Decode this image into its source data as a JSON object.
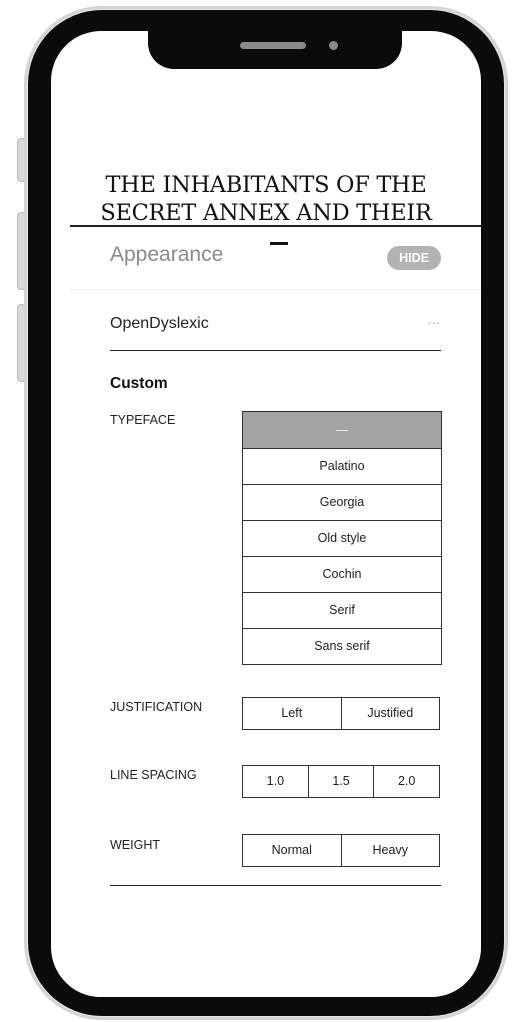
{
  "book": {
    "title_lines": [
      "THE INHABITANTS OF THE",
      "SECRET ANNEX AND THEIR"
    ]
  },
  "panel": {
    "title": "Appearance",
    "hide_label": "HIDE",
    "font_preset": "OpenDyslexic",
    "more_icon": "...",
    "custom_heading": "Custom"
  },
  "typeface": {
    "label": "TYPEFACE",
    "selected": "—",
    "options": [
      "Palatino",
      "Georgia",
      "Old style",
      "Cochin",
      "Serif",
      "Sans serif"
    ]
  },
  "justification": {
    "label": "JUSTIFICATION",
    "options": [
      "Left",
      "Justified"
    ]
  },
  "line_spacing": {
    "label": "LINE SPACING",
    "options": [
      "1.0",
      "1.5",
      "2.0"
    ]
  },
  "weight": {
    "label": "WEIGHT",
    "options": [
      "Normal",
      "Heavy"
    ]
  },
  "colors": {
    "frame": "#0b0b0b",
    "selected_option": "#a3a3a3",
    "hide_button": "#b3b3b3",
    "muted_text": "#8b8b8b"
  }
}
